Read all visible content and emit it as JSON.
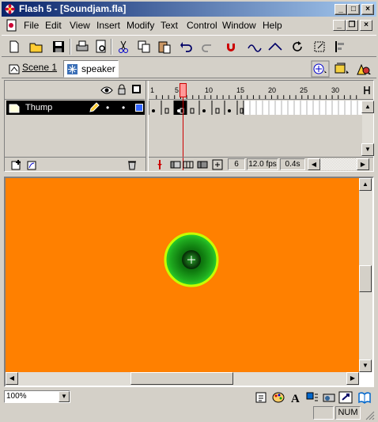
{
  "window": {
    "title": "Flash 5 - [Soundjam.fla]",
    "buttons": {
      "minimize": "_",
      "maximize": "□",
      "close": "×"
    }
  },
  "menubar": {
    "items": [
      {
        "label": "File"
      },
      {
        "label": "Edit"
      },
      {
        "label": "View"
      },
      {
        "label": "Insert"
      },
      {
        "label": "Modify"
      },
      {
        "label": "Text"
      },
      {
        "label": "Control"
      },
      {
        "label": "Window"
      },
      {
        "label": "Help"
      }
    ],
    "doc_buttons": {
      "minimize": "_",
      "restore": "❐",
      "close": "×"
    }
  },
  "editbar": {
    "scene_label": "Scene 1",
    "symbol_label": "speaker"
  },
  "timeline": {
    "layer_name": "Thump",
    "ruler_ticks": [
      "1",
      "5",
      "10",
      "15",
      "20",
      "25",
      "30"
    ],
    "current_frame": "6",
    "frame_rate": "12.0 fps",
    "elapsed_time": "0.4s"
  },
  "stage": {
    "background_color": "#ff8000",
    "speaker_color": "#1faa1f",
    "speaker_ring_color": "#c8ff00"
  },
  "bottom": {
    "zoom_value": "100%",
    "status_num": "NUM"
  }
}
